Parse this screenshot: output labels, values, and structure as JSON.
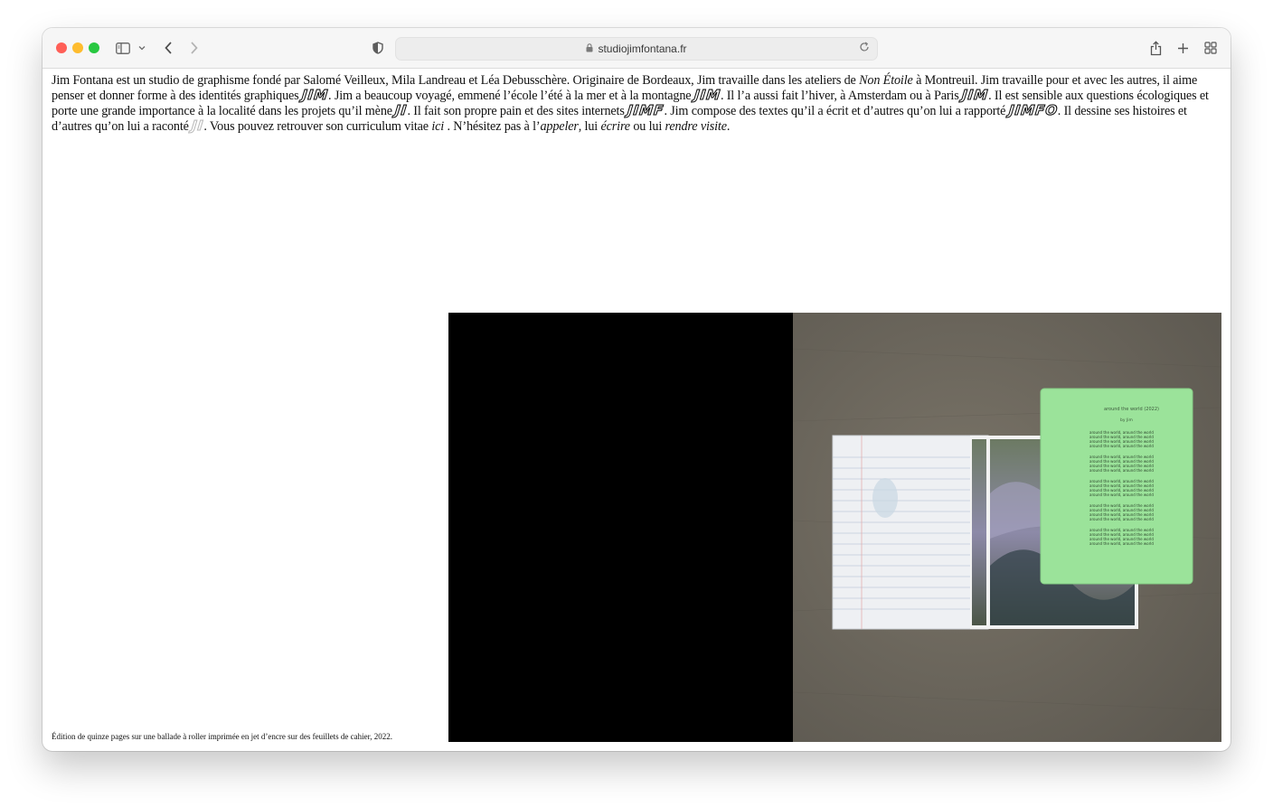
{
  "browser": {
    "url": "studiojimfontana.fr",
    "colors": {
      "close": "#ff5f57",
      "minimize": "#febc2e",
      "zoom": "#28c840"
    },
    "icons": [
      "sidebar-icon",
      "chevron-down-icon",
      "back-icon",
      "forward-icon",
      "shield-icon",
      "lock-icon",
      "reload-icon",
      "share-icon",
      "new-tab-icon",
      "tab-overview-icon"
    ]
  },
  "intro": {
    "s1": "Jim Fontana est un studio de graphisme fondé par Salomé Veilleux, Mila Landreau et Léa Debusschère. Originaire de Bordeaux, Jim travaille dans les ateliers de ",
    "s1_em": "Non Étoile",
    "s2": " à Montreuil. Jim travaille pour et avec les autres, il aime penser et donner forme à des identités graphiques ",
    "logo1": "JIM",
    "s3": ". Jim a beaucoup voyagé, emmené l’école l’été à la mer et à la montagne ",
    "logo2": "JIM",
    "s4": ". Il l’a aussi fait l’hiver, à Amsterdam ou à Paris ",
    "logo3": "JIM",
    "s5": ". Il est sensible aux questions écologiques et porte une grande importance à la localité dans les projets qu’il mène ",
    "logo4": "JI",
    "s6": ". Il fait son propre pain et des sites internets ",
    "logo5": "JIMF",
    "s7": ". Jim compose des textes qu’il a écrit et d’autres qu’on lui a rapporté ",
    "logo6": "JIMFO",
    "s8": ". Il dessine ses histoires et d’autres qu’on lui a raconté ",
    "logo7": "JI",
    "s9": ". Vous pouvez retrouver son curriculum vitae ",
    "link_cv": "ici",
    "s10": " . N’hésitez pas à l’",
    "link_call": "appeler",
    "s11": ", lui ",
    "link_write": "écrire",
    "s12": " ou lui ",
    "link_visit": "rendre visite",
    "s13": "."
  },
  "caption": "Édition de quinze pages sur une ballade à roller imprimée en jet d’encre sur des feuillets de cahier, 2022.",
  "photo": {
    "green_sheet": {
      "title": "around the world (2022)",
      "subtitle": "by Jim",
      "line": "around the world, around the world"
    },
    "colors": {
      "concrete": "#6e695f",
      "green_paper": "#9be39a",
      "black_panel": "#000000"
    }
  }
}
